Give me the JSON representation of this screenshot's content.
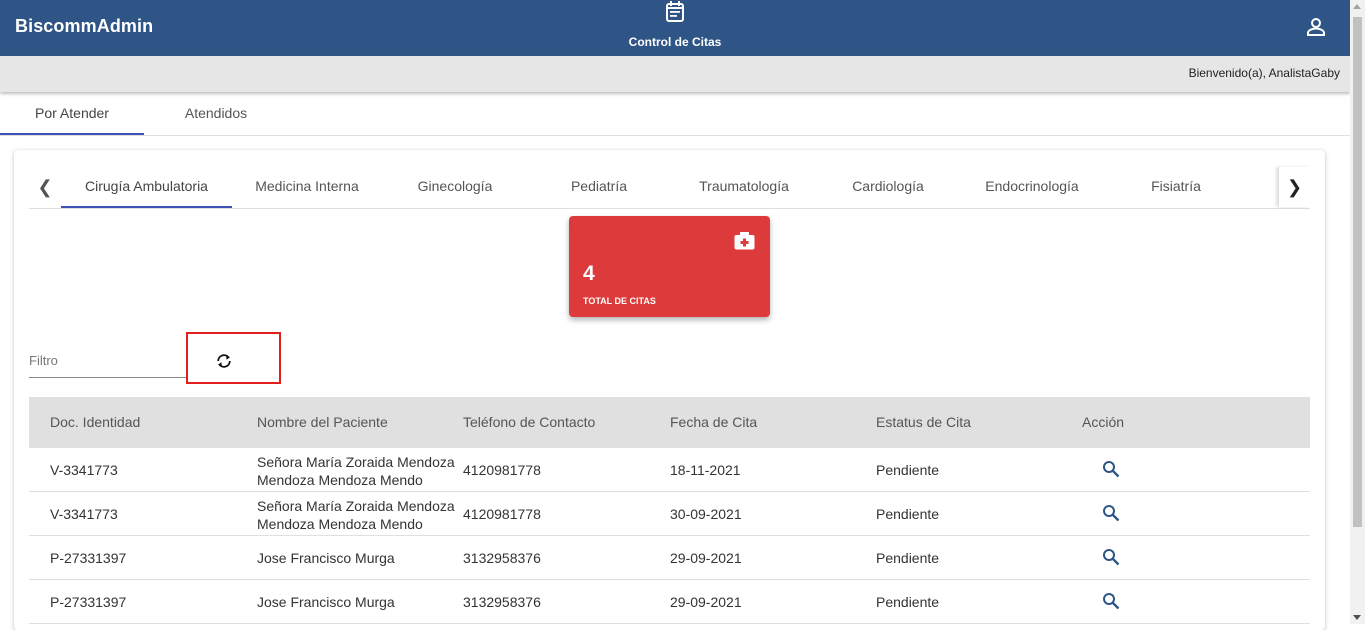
{
  "app": {
    "brand": "BiscommAdmin",
    "center_nav_label": "Control de Citas",
    "center_nav_icon": "calendar-icon",
    "user_icon": "person-icon",
    "welcome": "Bienvenido(a), AnalistaGaby",
    "primary_color": "#2e5585"
  },
  "main_tabs": [
    {
      "label": "Por Atender",
      "active": true
    },
    {
      "label": "Atendidos",
      "active": false
    }
  ],
  "specialty_tabs": [
    {
      "label": "Cirugía Ambulatoria",
      "active": true
    },
    {
      "label": "Medicina Interna",
      "active": false
    },
    {
      "label": "Ginecología",
      "active": false
    },
    {
      "label": "Pediatría",
      "active": false
    },
    {
      "label": "Traumatología",
      "active": false
    },
    {
      "label": "Cardiología",
      "active": false
    },
    {
      "label": "Endocrinología",
      "active": false
    },
    {
      "label": "Fisiatría",
      "active": false
    }
  ],
  "stat_card": {
    "value": "4",
    "caption": "TOTAL DE CITAS",
    "icon": "medical-kit-icon",
    "color": "#dd3b3b"
  },
  "filter": {
    "placeholder": "Filtro",
    "value": ""
  },
  "table": {
    "headers": [
      "Doc. Identidad",
      "Nombre del Paciente",
      "Teléfono de Contacto",
      "Fecha de Cita",
      "Estatus de Cita",
      "Acción"
    ],
    "rows": [
      {
        "doc": "V-3341773",
        "name_line1": "Señora María Zoraida Mendoza",
        "name_line2": "Mendoza Mendoza Mendo",
        "phone": "4120981778",
        "date": "18-11-2021",
        "status": "Pendiente"
      },
      {
        "doc": "V-3341773",
        "name_line1": "Señora María Zoraida Mendoza",
        "name_line2": "Mendoza Mendoza Mendo",
        "phone": "4120981778",
        "date": "30-09-2021",
        "status": "Pendiente"
      },
      {
        "doc": "P-27331397",
        "name_line1": "Jose Francisco Murga",
        "name_line2": "",
        "phone": "3132958376",
        "date": "29-09-2021",
        "status": "Pendiente"
      },
      {
        "doc": "P-27331397",
        "name_line1": "Jose Francisco Murga",
        "name_line2": "",
        "phone": "3132958376",
        "date": "29-09-2021",
        "status": "Pendiente"
      }
    ]
  }
}
